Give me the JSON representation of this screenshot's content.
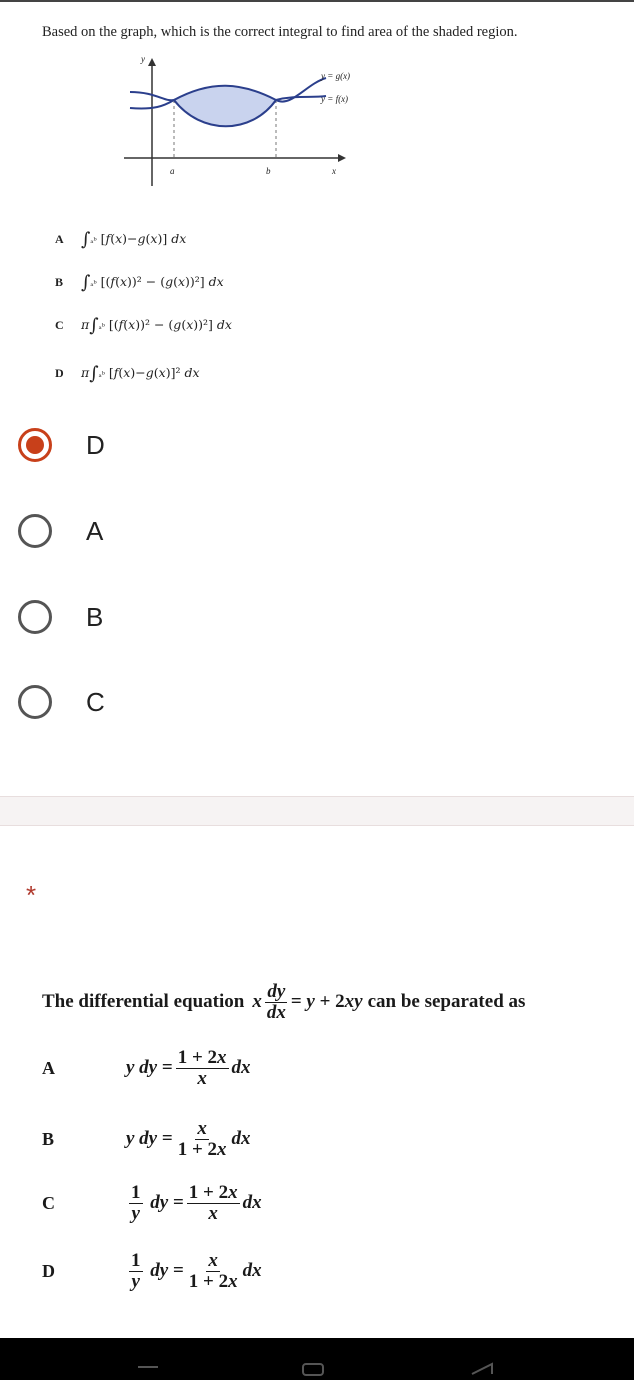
{
  "question1": {
    "prompt": "Based on the graph, which is the correct integral to find area of the shaded region.",
    "graph": {
      "y_axis": "y",
      "x_axis": "x",
      "label_g": "y = g(x)",
      "label_f": "y = f(x)",
      "tick_a": "a",
      "tick_b": "b"
    },
    "image_options": [
      {
        "letter": "A"
      },
      {
        "letter": "B"
      },
      {
        "letter": "C"
      },
      {
        "letter": "D"
      }
    ],
    "choices": [
      {
        "label": "D",
        "selected": true
      },
      {
        "label": "A",
        "selected": false
      },
      {
        "label": "B",
        "selected": false
      },
      {
        "label": "C",
        "selected": false
      }
    ]
  },
  "question2": {
    "required_mark": "*",
    "prompt_start": "The differential equation",
    "prompt_end": "can be separated as",
    "options": [
      {
        "letter": "A"
      },
      {
        "letter": "B"
      },
      {
        "letter": "C"
      },
      {
        "letter": "D"
      }
    ]
  },
  "colors": {
    "accent": "#c8401a",
    "curve": "#2b3f8c",
    "shade": "#c9d3ee"
  }
}
